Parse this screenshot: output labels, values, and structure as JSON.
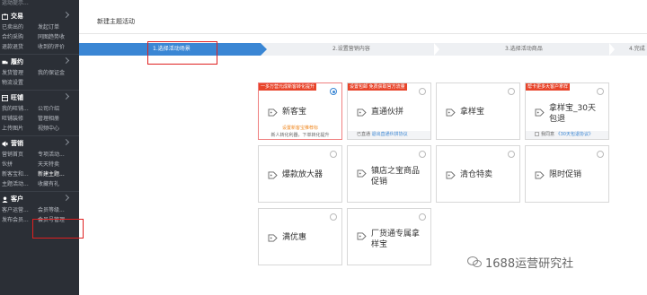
{
  "sidebar": {
    "top_fragment": "运动提示...",
    "groups": [
      {
        "title": "交易",
        "icon": "trade-icon",
        "rows": [
          [
            "已卖出的",
            "发起订单"
          ],
          [
            "合约采购",
            "同图趋势收"
          ],
          [
            "退款退货",
            "收到的评价"
          ]
        ]
      },
      {
        "title": "履约",
        "icon": "fulfillment-icon",
        "rows": [
          [
            "发货管理",
            "我的保证金"
          ],
          [
            "物流设置",
            ""
          ]
        ]
      },
      {
        "title": "旺铺",
        "icon": "shop-icon",
        "rows": [
          [
            "我的旺铺...",
            "公司介绍"
          ],
          [
            "旺铺装修",
            "管理相册"
          ],
          [
            "上传图片",
            "视频中心"
          ]
        ]
      },
      {
        "title": "营销",
        "icon": "marketing-icon",
        "rows": [
          [
            "营销首页",
            "专项活动..."
          ],
          [
            "伙拼",
            "天天特卖"
          ],
          [
            "新客宝和...",
            "新建主题..."
          ],
          [
            "主题活动...",
            "收藏有礼"
          ]
        ]
      },
      {
        "title": "客户",
        "icon": "customer-icon",
        "rows": [
          [
            "客户运营...",
            "会员等级..."
          ],
          [
            "发布会员...",
            "会员号管理"
          ]
        ]
      }
    ]
  },
  "page_title": "新建主题活动",
  "steps": [
    "1.选择活动场景",
    "2.设置营销内容",
    "3.选择活动商品",
    "4.完成"
  ],
  "cards": [
    {
      "name": "新客宝",
      "badge": "一多万营元成新客转化提升",
      "badge_color": "#e8442a",
      "selected": true,
      "sub1": "设置新客宝推荐标",
      "sub2": "新人转化利器，下单转化提升"
    },
    {
      "name": "直通伙拼",
      "badge": "设置包邮 免费获取官方流量",
      "badge_color": "#e8442a",
      "footer_pre": "已直通",
      "footer_link": "退出直通伙拼协议"
    },
    {
      "name": "拿样宝"
    },
    {
      "name": "拿样宝_30天包退",
      "badge": "帮卡更多大客户拿样",
      "badge_color": "#e8442a",
      "footer_pre": "我同意",
      "footer_link": "《30天包退协议》",
      "footer_check": true
    },
    {
      "name": "爆款放大器"
    },
    {
      "name": "镇店之宝商品促销"
    },
    {
      "name": "清仓特卖"
    },
    {
      "name": "限时促销"
    },
    {
      "name": "满优惠"
    },
    {
      "name": "厂货通专属拿样宝"
    }
  ],
  "watermark": "1688运营研究社",
  "colors": {
    "accent": "#3a86d4",
    "sidebar_bg": "#2b2f36",
    "annotation": "#e02020",
    "badge": "#e8442a"
  }
}
